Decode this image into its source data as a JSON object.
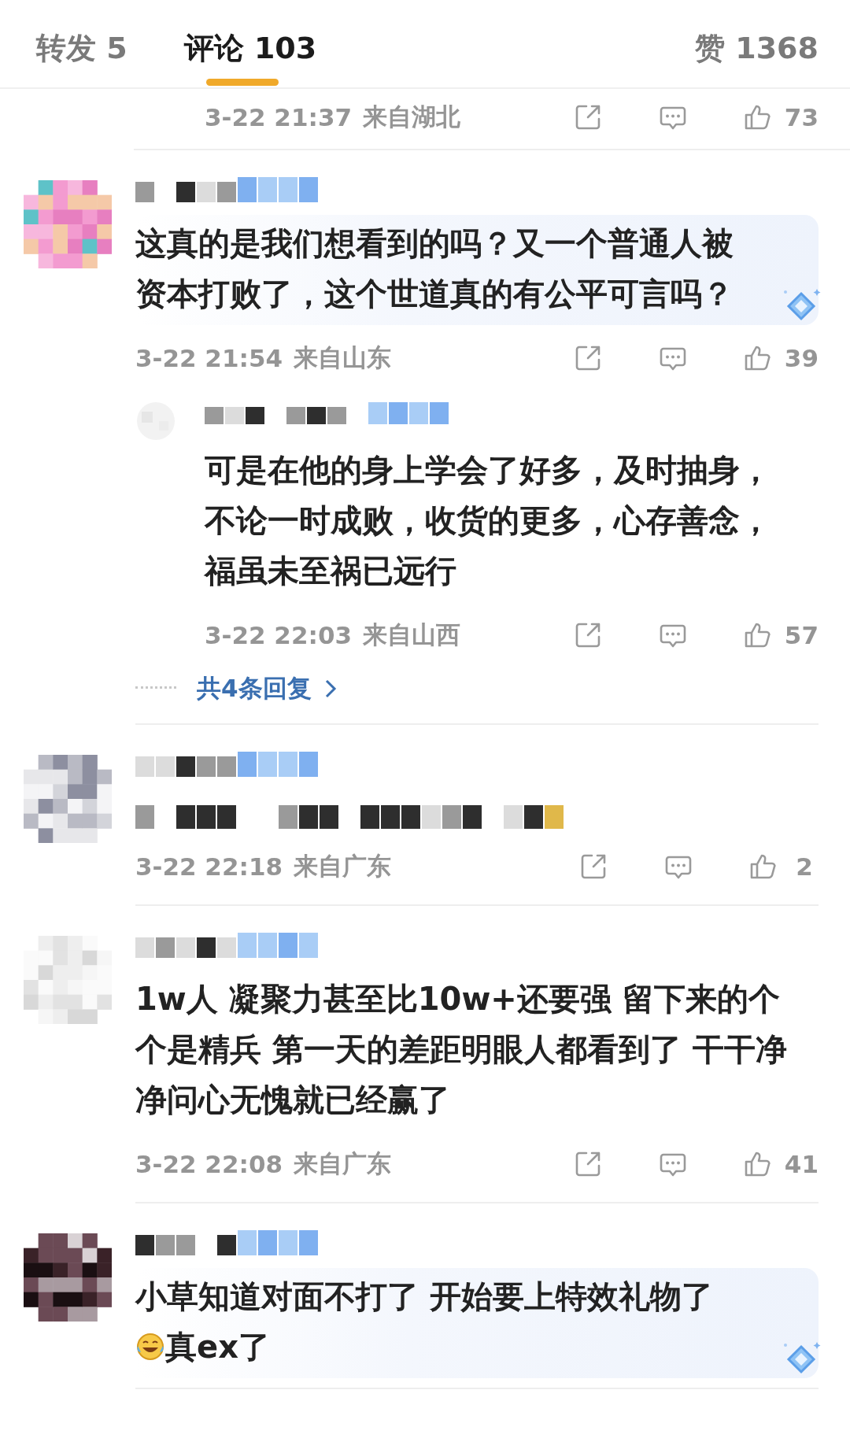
{
  "tabs": [
    {
      "label": "转发 5",
      "selected": false
    },
    {
      "label": "评论 103",
      "selected": true
    }
  ],
  "likes_total": "赞 1368",
  "comments": [
    {
      "kind": "meta_only",
      "time": "3-22 21:37",
      "location": "来自湖北",
      "likes": "73"
    },
    {
      "kind": "comment",
      "highlighted": true,
      "paragraphs": [
        {
          "kind": "text",
          "text": "这真的是我们想看到的吗？又一个普通人被资本打败了，这个世道真的有公平可言吗？"
        }
      ],
      "time": "3-22 21:54",
      "location": "来自山东",
      "likes": "39",
      "replies": [
        {
          "paragraphs": [
            {
              "kind": "text",
              "text": "可是在他的身上学会了好多，及时抽身，不论一时成败，收货的更多，心存善念，福虽未至祸已远行"
            }
          ],
          "time": "3-22 22:03",
          "location": "来自山西",
          "likes": "57"
        }
      ],
      "more_replies": "共4条回复"
    },
    {
      "kind": "comment",
      "censored": true,
      "time": "3-22 22:18",
      "location": "来自广东",
      "likes": "2"
    },
    {
      "kind": "comment",
      "highlighted": false,
      "paragraphs": [
        {
          "kind": "text",
          "text": "1w人 凝聚力甚至比10w+还要强 留下来的个个是精兵 第一天的差距明眼人都看到了 干干净净问心无愧就已经赢了"
        }
      ],
      "time": "3-22 22:08",
      "location": "来自广东",
      "likes": "41"
    },
    {
      "kind": "comment",
      "highlighted": true,
      "paragraphs": [
        {
          "kind": "text",
          "text": "小草知道对面不打了 开始要上特效礼物了"
        },
        {
          "kind": "emoji",
          "text": "真ex了"
        }
      ]
    }
  ]
}
